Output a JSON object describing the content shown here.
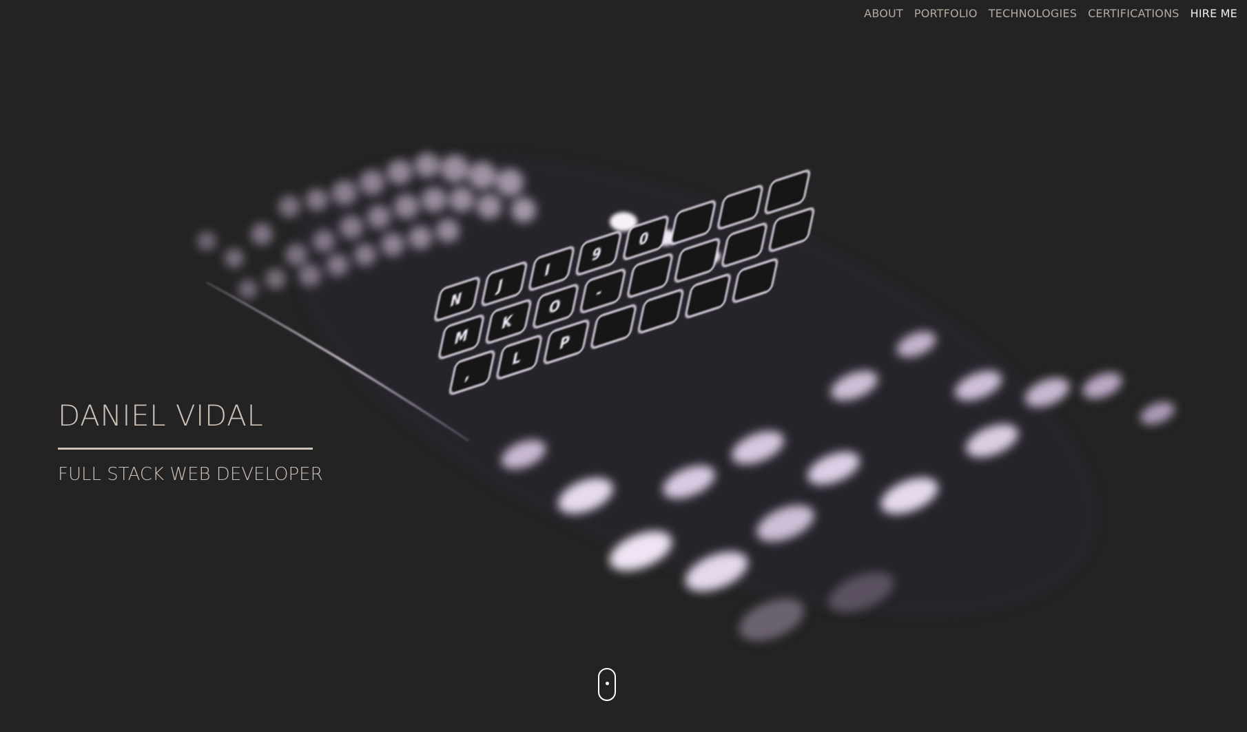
{
  "nav": {
    "items": [
      {
        "label": "ABOUT"
      },
      {
        "label": "PORTFOLIO"
      },
      {
        "label": "TECHNOLOGIES"
      },
      {
        "label": "CERTIFICATIONS"
      },
      {
        "label": "HIRE ME"
      }
    ]
  },
  "hero": {
    "name": "DANIEL VIDAL",
    "subtitle": "FULL STACK WEB DEVELOPER",
    "background_image": "backlit-keyboard-photo"
  },
  "scroll_indicator": {
    "icon": "mouse-scroll-icon"
  },
  "colors": {
    "background": "#232323",
    "title_text": "#cec2b7",
    "nav_text": "#b4aaa1",
    "nav_highlight": "#f4f0ec",
    "key_glow": "#e6d8f0"
  }
}
